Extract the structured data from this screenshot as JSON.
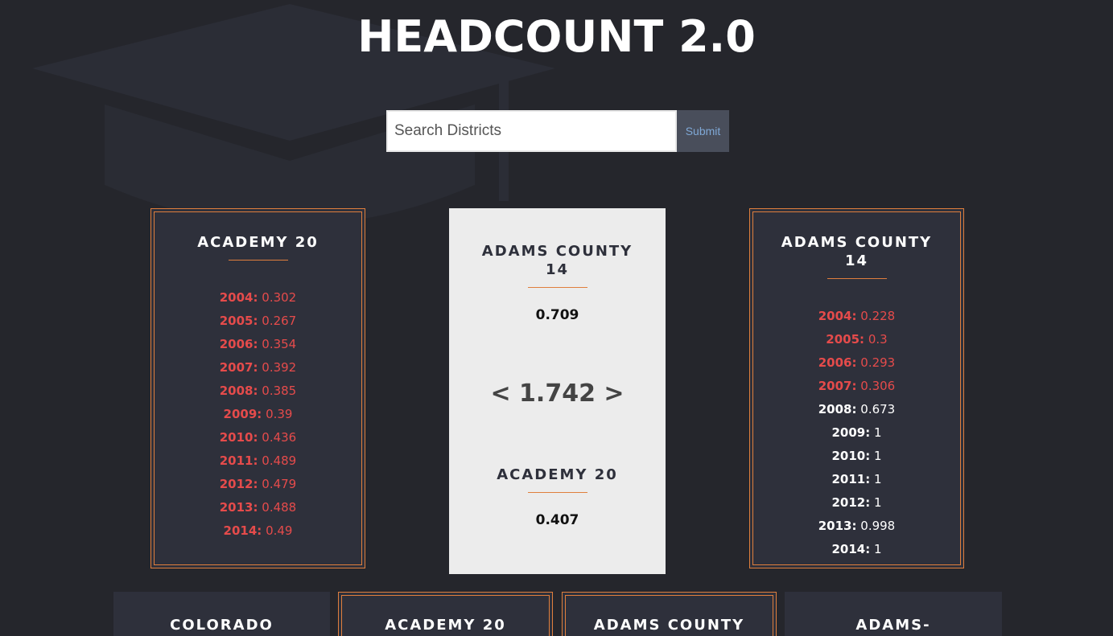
{
  "header": {
    "title": "HEADCOUNT 2.0"
  },
  "search": {
    "placeholder": "Search Districts",
    "submit_label": "Submit"
  },
  "left_card": {
    "title": "ACADEMY 20",
    "rows": [
      {
        "year": "2004:",
        "value": "0.302",
        "status": "low"
      },
      {
        "year": "2005:",
        "value": "0.267",
        "status": "low"
      },
      {
        "year": "2006:",
        "value": "0.354",
        "status": "low"
      },
      {
        "year": "2007:",
        "value": "0.392",
        "status": "low"
      },
      {
        "year": "2008:",
        "value": "0.385",
        "status": "low"
      },
      {
        "year": "2009:",
        "value": "0.39",
        "status": "low"
      },
      {
        "year": "2010:",
        "value": "0.436",
        "status": "low"
      },
      {
        "year": "2011:",
        "value": "0.489",
        "status": "low"
      },
      {
        "year": "2012:",
        "value": "0.479",
        "status": "low"
      },
      {
        "year": "2013:",
        "value": "0.488",
        "status": "low"
      },
      {
        "year": "2014:",
        "value": "0.49",
        "status": "low"
      }
    ]
  },
  "comparison": {
    "top_name_line1": "ADAMS COUNTY",
    "top_name_line2": "14",
    "top_value": "0.709",
    "ratio": "< 1.742 >",
    "bottom_name": "ACADEMY 20",
    "bottom_value": "0.407"
  },
  "right_card": {
    "title_line1": "ADAMS COUNTY",
    "title_line2": "14",
    "rows": [
      {
        "year": "2004:",
        "value": "0.228",
        "status": "low"
      },
      {
        "year": "2005:",
        "value": "0.3",
        "status": "low"
      },
      {
        "year": "2006:",
        "value": "0.293",
        "status": "low"
      },
      {
        "year": "2007:",
        "value": "0.306",
        "status": "low"
      },
      {
        "year": "2008:",
        "value": "0.673",
        "status": "high"
      },
      {
        "year": "2009:",
        "value": "1",
        "status": "high"
      },
      {
        "year": "2010:",
        "value": "1",
        "status": "high"
      },
      {
        "year": "2011:",
        "value": "1",
        "status": "high"
      },
      {
        "year": "2012:",
        "value": "1",
        "status": "high"
      },
      {
        "year": "2013:",
        "value": "0.998",
        "status": "high"
      },
      {
        "year": "2014:",
        "value": "1",
        "status": "high"
      }
    ]
  },
  "bottom_cards": [
    {
      "title": "COLORADO",
      "selected": false
    },
    {
      "title": "ACADEMY 20",
      "selected": true
    },
    {
      "title": "ADAMS COUNTY",
      "selected": true
    },
    {
      "title": "ADAMS-",
      "selected": false
    }
  ],
  "colors": {
    "background": "#25262c",
    "card": "#2e303b",
    "accent": "#e07f3d",
    "low": "#e54b4b",
    "high": "#ffffff"
  },
  "icons": {
    "background": "graduation-cap-icon"
  }
}
